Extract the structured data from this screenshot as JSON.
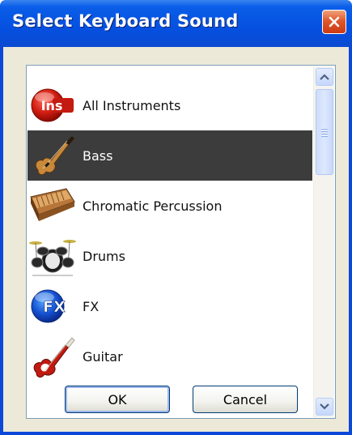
{
  "window": {
    "title": "Select Keyboard Sound",
    "close_icon": "close-icon"
  },
  "list": {
    "items": [
      {
        "label": "All Instruments",
        "icon": "all-instruments-icon",
        "badge": "Ins",
        "selected": false
      },
      {
        "label": "Bass",
        "icon": "bass-guitar-icon",
        "selected": true
      },
      {
        "label": "Chromatic Percussion",
        "icon": "xylophone-icon",
        "selected": false
      },
      {
        "label": "Drums",
        "icon": "drum-kit-icon",
        "selected": false
      },
      {
        "label": "FX",
        "icon": "fx-icon",
        "badge": "FX",
        "selected": false
      },
      {
        "label": "Guitar",
        "icon": "electric-guitar-icon",
        "selected": false
      }
    ]
  },
  "scrollbar": {
    "up_icon": "scroll-up-icon",
    "down_icon": "scroll-down-icon"
  },
  "buttons": {
    "ok_label": "OK",
    "cancel_label": "Cancel"
  },
  "colors": {
    "title_bar": "#0a5ee8",
    "selection": "#3c3c3c",
    "dialog_bg": "#ece9d8",
    "close_button": "#e0582e"
  }
}
